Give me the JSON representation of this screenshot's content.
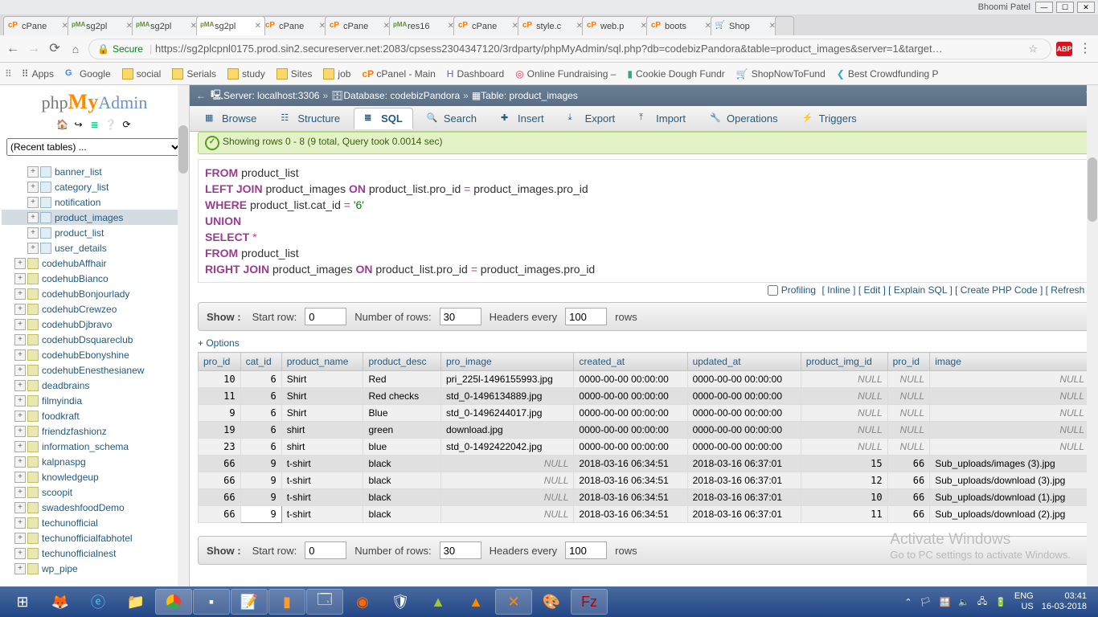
{
  "window": {
    "user": "Bhoomi Patel"
  },
  "browser": {
    "tabs": [
      {
        "fav": "cP",
        "favcls": "cp",
        "label": "cPane"
      },
      {
        "fav": "pMA",
        "favcls": "pma",
        "label": "sg2pl"
      },
      {
        "fav": "pMA",
        "favcls": "pma",
        "label": "sg2pl"
      },
      {
        "fav": "pMA",
        "favcls": "pma",
        "label": "sg2pl",
        "active": true
      },
      {
        "fav": "cP",
        "favcls": "cp",
        "label": "cPane"
      },
      {
        "fav": "cP",
        "favcls": "cp",
        "label": "cPane"
      },
      {
        "fav": "pMA",
        "favcls": "pma",
        "label": "res16"
      },
      {
        "fav": "cP",
        "favcls": "cp",
        "label": "cPane"
      },
      {
        "fav": "cP",
        "favcls": "cp",
        "label": "style.c"
      },
      {
        "fav": "cP",
        "favcls": "cp",
        "label": "web.p"
      },
      {
        "fav": "cP",
        "favcls": "cp",
        "label": "boots"
      },
      {
        "fav": "🛒",
        "favcls": "shop",
        "label": "Shop"
      }
    ],
    "secure": "Secure",
    "url": "https://sg2plcpnl0175.prod.sin2.secureserver.net:2083/cpsess2304347120/3rdparty/phpMyAdmin/sql.php?db=codebizPandora&table=product_images&server=1&target…",
    "bookmarks": [
      {
        "ic": "grid",
        "label": "Apps"
      },
      {
        "ic": "goog",
        "label": "Google"
      },
      {
        "ic": "fold",
        "label": "social"
      },
      {
        "ic": "fold",
        "label": "Serials"
      },
      {
        "ic": "fold",
        "label": "study"
      },
      {
        "ic": "fold",
        "label": "Sites"
      },
      {
        "ic": "fold",
        "label": "job"
      },
      {
        "ic": "cp",
        "label": "cPanel - Main"
      },
      {
        "ic": "dash",
        "label": "Dashboard"
      },
      {
        "ic": "fund",
        "label": "Online Fundraising –"
      },
      {
        "ic": "cookie",
        "label": "Cookie Dough Fundr"
      },
      {
        "ic": "shop",
        "label": "ShopNowToFund"
      },
      {
        "ic": "bird",
        "label": "Best Crowdfunding P"
      }
    ]
  },
  "pma": {
    "recent_label": "(Recent tables) ...",
    "breadcrumb": {
      "server_lbl": "Server:",
      "server": "localhost:3306",
      "db_lbl": "Database:",
      "db": "codebizPandora",
      "tbl_lbl": "Table:",
      "tbl": "product_images"
    },
    "tabs": [
      {
        "label": "Browse",
        "ic": "▦"
      },
      {
        "label": "Structure",
        "ic": "☷"
      },
      {
        "label": "SQL",
        "ic": "≣",
        "active": true
      },
      {
        "label": "Search",
        "ic": "🔍"
      },
      {
        "label": "Insert",
        "ic": "✚"
      },
      {
        "label": "Export",
        "ic": "⤓"
      },
      {
        "label": "Import",
        "ic": "⤒"
      },
      {
        "label": "Operations",
        "ic": "🔧"
      },
      {
        "label": "Triggers",
        "ic": "⚡"
      }
    ],
    "tree_tables": [
      {
        "name": "banner_list"
      },
      {
        "name": "category_list"
      },
      {
        "name": "notification"
      },
      {
        "name": "product_images",
        "sel": true
      },
      {
        "name": "product_list"
      },
      {
        "name": "user_details"
      }
    ],
    "tree_dbs": [
      "codehubAffhair",
      "codehubBianco",
      "codehubBonjourlady",
      "codehubCrewzeo",
      "codehubDjbravo",
      "codehubDsquareclub",
      "codehubEbonyshine",
      "codehubEnesthesianew",
      "deadbrains",
      "filmyindia",
      "foodkraft",
      "friendzfashionz",
      "information_schema",
      "kalpnaspg",
      "knowledgeup",
      "scoopit",
      "swadeshfoodDemo",
      "techunofficial",
      "techunofficialfabhotel",
      "techunofficialnest",
      "wp_pipe"
    ],
    "msg": "Showing rows 0 - 8 (9 total, Query took 0.0014 sec)",
    "sql": {
      "l1a": "FROM",
      "l1b": " product_list",
      "l2a": "LEFT JOIN",
      "l2b": " product_images ",
      "l2c": "ON",
      "l2d": " product_list.pro_id ",
      "l2e": "=",
      "l2f": " product_images.pro_id",
      "l3a": "WHERE",
      "l3b": " product_list.cat_id ",
      "l3c": "=",
      "l3d": " '6'",
      "l4": "UNION",
      "l5a": "SELECT",
      "l5b": " *",
      "l6a": "FROM",
      "l6b": " product_list",
      "l7a": "RIGHT JOIN",
      "l7b": " product_images ",
      "l7c": "ON",
      "l7d": " product_list.pro_id ",
      "l7e": "=",
      "l7f": " product_images.pro_id"
    },
    "links": {
      "profiling": "Profiling",
      "inline": "Inline",
      "edit": "Edit",
      "explain": "Explain SQL",
      "php": "Create PHP Code",
      "refresh": "Refresh"
    },
    "nav": {
      "show": "Show :",
      "start": "Start row:",
      "start_v": "0",
      "rows": "Number of rows:",
      "rows_v": "30",
      "head": "Headers every",
      "head_v": "100",
      "tail": "rows"
    },
    "options": "+ Options",
    "columns": [
      "pro_id",
      "cat_id",
      "product_name",
      "product_desc",
      "pro_image",
      "created_at",
      "updated_at",
      "product_img_id",
      "pro_id",
      "image"
    ],
    "rows": [
      [
        "10",
        "6",
        "Shirt",
        "Red",
        "pri_225l-1496155993.jpg",
        "0000-00-00 00:00:00",
        "0000-00-00 00:00:00",
        "NULL",
        "NULL",
        "NULL"
      ],
      [
        "11",
        "6",
        "Shirt",
        "Red checks",
        "std_0-1496134889.jpg",
        "0000-00-00 00:00:00",
        "0000-00-00 00:00:00",
        "NULL",
        "NULL",
        "NULL"
      ],
      [
        "9",
        "6",
        "Shirt",
        "Blue",
        "std_0-1496244017.jpg",
        "0000-00-00 00:00:00",
        "0000-00-00 00:00:00",
        "NULL",
        "NULL",
        "NULL"
      ],
      [
        "19",
        "6",
        "shirt",
        "green",
        "download.jpg",
        "0000-00-00 00:00:00",
        "0000-00-00 00:00:00",
        "NULL",
        "NULL",
        "NULL"
      ],
      [
        "23",
        "6",
        "shirt",
        "blue",
        "std_0-1492422042.jpg",
        "0000-00-00 00:00:00",
        "0000-00-00 00:00:00",
        "NULL",
        "NULL",
        "NULL"
      ],
      [
        "66",
        "9",
        "t-shirt",
        "black",
        "NULL",
        "2018-03-16 06:34:51",
        "2018-03-16 06:37:01",
        "15",
        "66",
        "Sub_uploads/images (3).jpg"
      ],
      [
        "66",
        "9",
        "t-shirt",
        "black",
        "NULL",
        "2018-03-16 06:34:51",
        "2018-03-16 06:37:01",
        "12",
        "66",
        "Sub_uploads/download (3).jpg"
      ],
      [
        "66",
        "9",
        "t-shirt",
        "black",
        "NULL",
        "2018-03-16 06:34:51",
        "2018-03-16 06:37:01",
        "10",
        "66",
        "Sub_uploads/download (1).jpg"
      ],
      [
        "66",
        "9",
        "t-shirt",
        "black",
        "NULL",
        "2018-03-16 06:34:51",
        "2018-03-16 06:37:01",
        "11",
        "66",
        "Sub_uploads/download (2).jpg"
      ]
    ],
    "numcols": [
      0,
      1,
      7,
      8
    ],
    "watermark": {
      "t": "Activate Windows",
      "s": "Go to PC settings to activate Windows."
    }
  },
  "taskbar": {
    "lang": "ENG",
    "loc": "US",
    "time": "03:41",
    "date": "16-03-2018"
  }
}
